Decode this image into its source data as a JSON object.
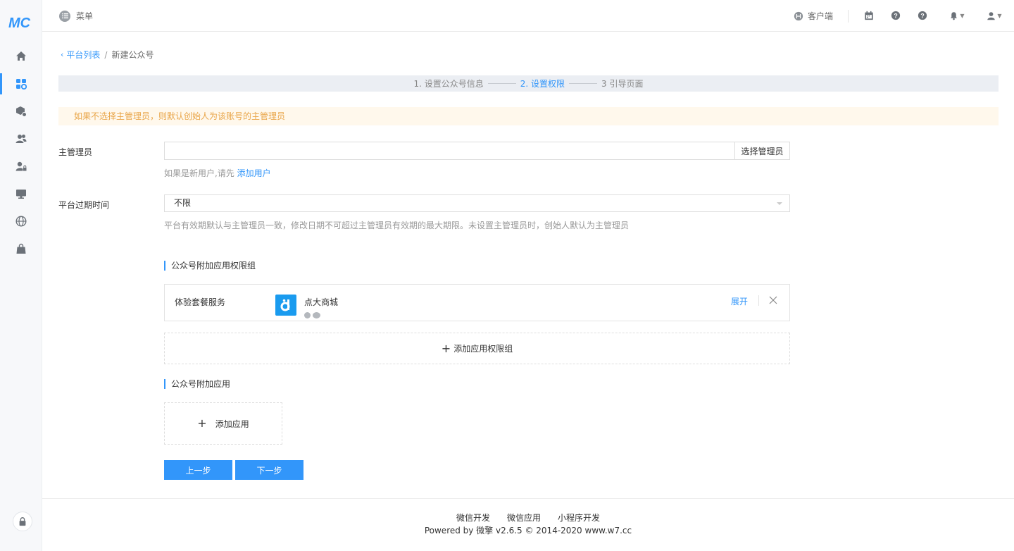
{
  "sidebar": {
    "logo": "MC",
    "icons": [
      "home-icon",
      "apps-icon",
      "module-icon",
      "users-icon",
      "user-lock-icon",
      "monitor-icon",
      "globe-icon",
      "bag-icon"
    ],
    "active_index": 1
  },
  "topbar": {
    "menu_label": "菜单",
    "client_label": "客户端"
  },
  "breadcrumb": {
    "back_label": "平台列表",
    "separator": "/",
    "current": "新建公众号"
  },
  "steps": [
    {
      "label": "1. 设置公众号信息",
      "active": false
    },
    {
      "label": "2. 设置权限",
      "active": true
    },
    {
      "label": "3 引导页面",
      "active": false
    }
  ],
  "alert": "如果不选择主管理员，则默认创始人为该账号的主管理员",
  "form": {
    "admin_label": "主管理员",
    "admin_value": "",
    "admin_button": "选择管理员",
    "admin_help_prefix": "如果是新用户,请先",
    "admin_help_link": "添加用户",
    "expire_label": "平台过期时间",
    "expire_value": "不限",
    "expire_help": "平台有效期默认与主管理员一致，修改日期不可超过主管理员有效期的最大期限。未设置主管理员时，创始人默认为主管理员"
  },
  "perm_section": {
    "title": "公众号附加应用权限组",
    "card": {
      "name": "体验套餐服务",
      "app_name": "点大商城",
      "expand_label": "展开"
    },
    "add_label": "添加应用权限组"
  },
  "app_section": {
    "title": "公众号附加应用",
    "add_label": "添加应用"
  },
  "buttons": {
    "prev": "上一步",
    "next": "下一步"
  },
  "footer": {
    "links": [
      "微信开发",
      "微信应用",
      "小程序开发"
    ],
    "copyright": "Powered by 微擎 v2.6.5 © 2014-2020 www.w7.cc"
  },
  "colors": {
    "accent": "#3296fa",
    "warning_text": "#e9a548",
    "warning_bg": "#fff8ec"
  }
}
